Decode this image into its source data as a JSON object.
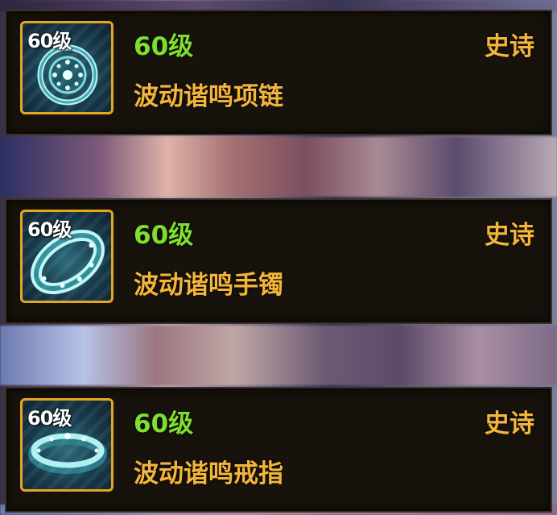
{
  "colors": {
    "level_green": "#7ee02e",
    "gold_text": "#f3b53a",
    "frame_gold": "#e3a61f",
    "card_bg": "#17120c"
  },
  "items": [
    {
      "badge": "60级",
      "level_label": "60级",
      "rarity": "史诗",
      "name": "波动谐鸣项链",
      "icon": "necklace-icon"
    },
    {
      "badge": "60级",
      "level_label": "60级",
      "rarity": "史诗",
      "name": "波动谐鸣手镯",
      "icon": "bracelet-icon"
    },
    {
      "badge": "60级",
      "level_label": "60级",
      "rarity": "史诗",
      "name": "波动谐鸣戒指",
      "icon": "ring-icon"
    }
  ]
}
